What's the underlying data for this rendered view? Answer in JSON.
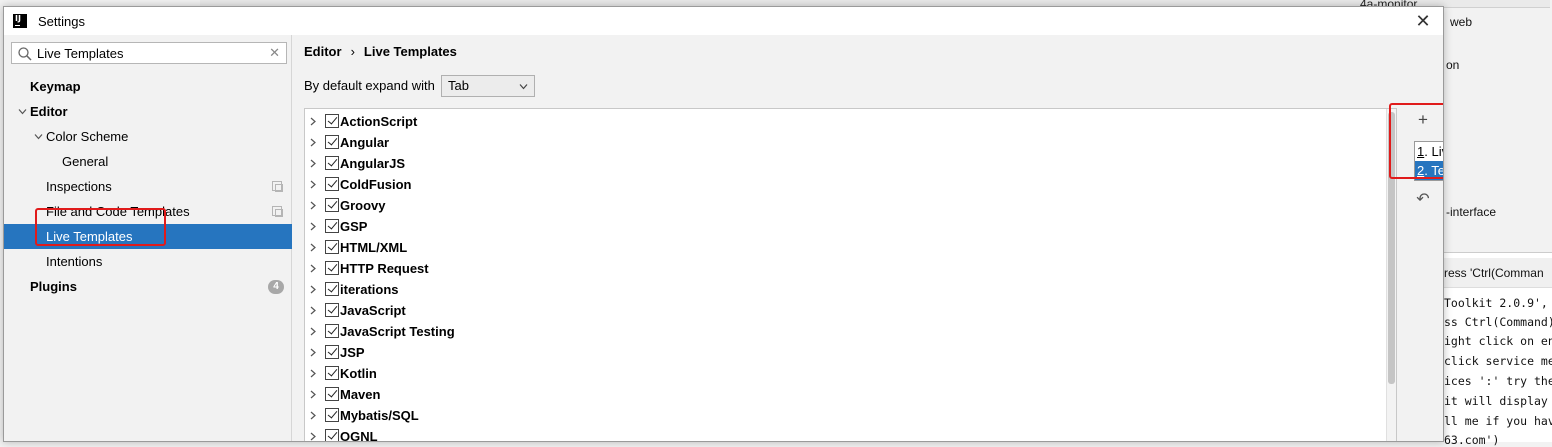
{
  "background": {
    "project_header": "4a-monitor",
    "side_texts": [
      {
        "text": "web"
      },
      {
        "text": "on"
      },
      {
        "text": "-interface"
      }
    ],
    "console_header": "ress 'Ctrl(Comman",
    "console_lines": [
      "Toolkit 2.0.9',",
      "ss Ctrl(Command)",
      "ight click on en",
      "click service me",
      "ices ':' try the",
      "it will display",
      "ll me if you hav",
      "63.com')"
    ]
  },
  "dialog": {
    "title": "Settings",
    "app_logo": "IJ",
    "close_icon": "✕"
  },
  "sidebar": {
    "search": {
      "value": "Live Templates",
      "clear_icon": "✕"
    },
    "items": [
      {
        "label": "Keymap"
      },
      {
        "label": "Editor"
      },
      {
        "label": "Color Scheme"
      },
      {
        "label": "General"
      },
      {
        "label": "Inspections"
      },
      {
        "label": "File and Code Templates"
      },
      {
        "label": "Live Templates"
      },
      {
        "label": "Intentions"
      },
      {
        "label": "Plugins",
        "badge": "4"
      }
    ]
  },
  "main": {
    "breadcrumb": {
      "parent": "Editor",
      "separator": "›",
      "current": "Live Templates"
    },
    "expand_label": "By default expand with",
    "expand_value": "Tab",
    "template_groups": [
      "ActionScript",
      "Angular",
      "AngularJS",
      "ColdFusion",
      "Groovy",
      "GSP",
      "HTML/XML",
      "HTTP Request",
      "iterations",
      "JavaScript",
      "JavaScript Testing",
      "JSP",
      "Kotlin",
      "Maven",
      "Mybatis/SQL",
      "OGNL"
    ],
    "toolbar": {
      "add_icon": "+",
      "undo_icon": "↶"
    },
    "add_menu": {
      "items": [
        {
          "number": "1",
          "label": ". Live Template"
        },
        {
          "number": "2",
          "label": ". Template Group..."
        }
      ]
    }
  },
  "colors": {
    "selection": "#2675bf",
    "annotation_red": "#e01b1b"
  }
}
